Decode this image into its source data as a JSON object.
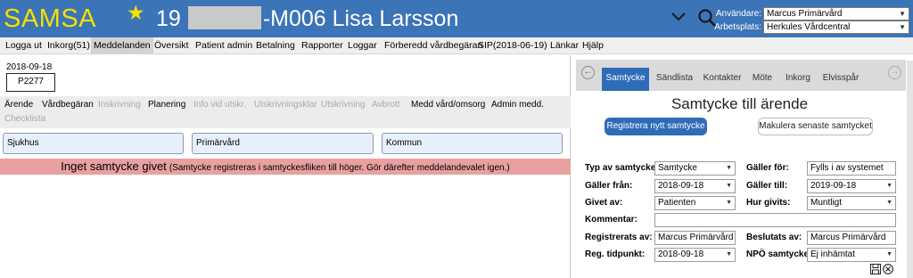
{
  "header": {
    "app_name": "SAMSA",
    "patient_prefix": "19",
    "patient_suffix": "-M006 Lisa Larsson",
    "user_label": "Användare:",
    "user_value": "Marcus Primärvård",
    "workplace_label": "Arbetsplats:",
    "workplace_value": "Herkules Vårdcentral",
    "colors": {
      "bar": "#3b74b7",
      "logo": "#f5e000"
    }
  },
  "menu": {
    "items": [
      "Logga ut",
      "Inkorg(51)",
      "Meddelanden",
      "Översikt",
      "Patient admin",
      "Betalning",
      "Rapporter",
      "Loggar",
      "Förberedd vårdbegäran",
      "SIP(2018-06-19)",
      "Länkar",
      "Hjälp"
    ],
    "active": "Meddelanden"
  },
  "left": {
    "date": "2018-09-18",
    "patient_code": "P2277",
    "tabs": [
      {
        "label": "Ärende",
        "disabled": false
      },
      {
        "label": "Vårdbegäran",
        "disabled": false
      },
      {
        "label": "Inskrivning",
        "disabled": true
      },
      {
        "label": "Planering",
        "disabled": false
      },
      {
        "label": "Info vid utskr.",
        "disabled": true
      },
      {
        "label": "Utskrivningsklar",
        "disabled": true
      },
      {
        "label": "Utskrivning",
        "disabled": true
      },
      {
        "label": "Avbrott",
        "disabled": true
      },
      {
        "label": "Medd vård/omsorg",
        "disabled": false
      },
      {
        "label": "Admin medd.",
        "disabled": false
      },
      {
        "label": "Checklista",
        "disabled": true
      }
    ],
    "care_units": [
      "Sjukhus",
      "Primärvård",
      "Kommun"
    ],
    "warning_main": "Inget samtycke givet",
    "warning_detail": "(Samtycke registreras i samtyckesfliken till höger. Gör därefter meddelandevalet igen.)"
  },
  "right": {
    "tabs": [
      "Samtycke",
      "Sändlista",
      "Kontakter",
      "Möte",
      "Inkorg",
      "Elvisspår"
    ],
    "active_tab": "Samtycke",
    "title": "Samtycke till ärende",
    "register_button": "Registrera nytt samtycke",
    "cancel_button": "Makulera senaste samtycket",
    "fields": {
      "typ_label": "Typ av samtycke:",
      "typ_value": "Samtycke",
      "galler_for_label": "Gäller för:",
      "galler_for_value": "Fylls i av systemet",
      "galler_fran_label": "Gäller från:",
      "galler_fran_value": "2018-09-18",
      "galler_till_label": "Gäller till:",
      "galler_till_value": "2019-09-18",
      "givet_av_label": "Givet av:",
      "givet_av_value": "Patienten",
      "hur_givits_label": "Hur givits:",
      "hur_givits_value": "Muntligt",
      "kommentar_label": "Kommentar:",
      "kommentar_value": "",
      "registrerats_label": "Registrerats av:",
      "registrerats_value": "Marcus Primärvård",
      "beslutats_label": "Beslutats av:",
      "beslutats_value": "Marcus Primärvård",
      "tidpunkt_label": "Reg. tidpunkt:",
      "tidpunkt_value": "2018-09-18",
      "npo_label": "NPÖ samtycke:",
      "npo_value": "Ej inhämtat"
    }
  },
  "icons": {
    "star": "star-icon",
    "chevron": "chevron-down-icon",
    "search": "search-icon",
    "prev": "arrow-left-icon",
    "next": "arrow-right-icon",
    "save": "save-icon",
    "close": "close-icon"
  }
}
